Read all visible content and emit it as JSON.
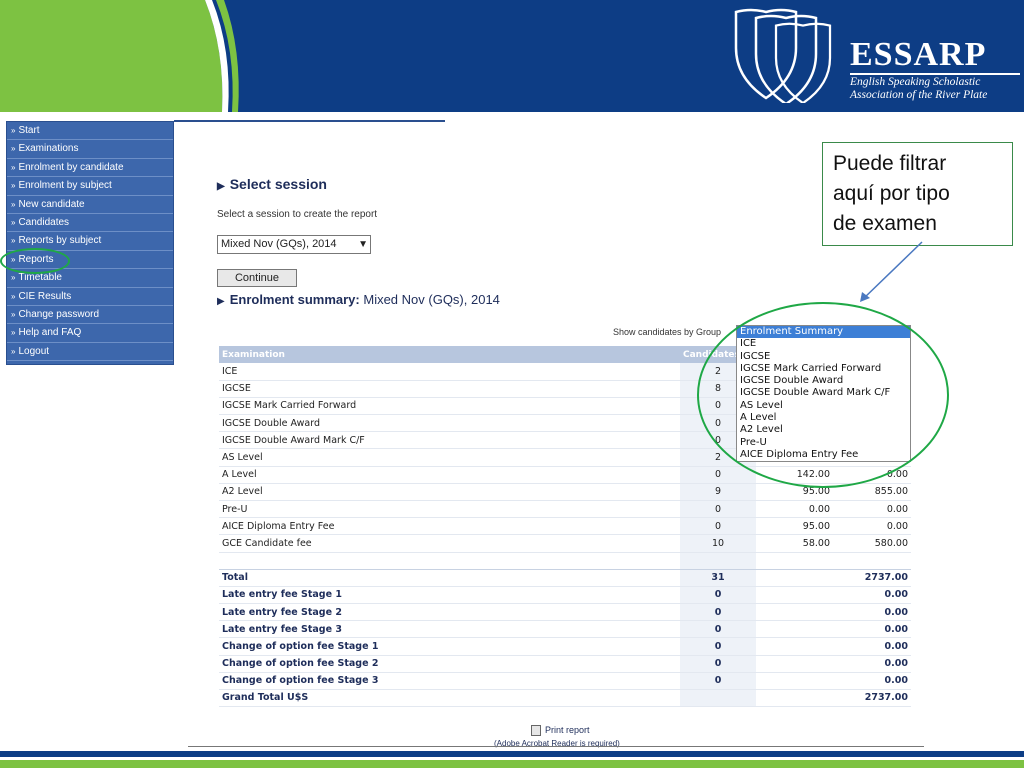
{
  "header": {
    "logo_title": "ESSARP",
    "logo_subtitle_line1": "English Speaking Scholastic",
    "logo_subtitle_line2": "Association of the River Plate",
    "brand_blue": "#0d3d85",
    "brand_green": "#7dc242"
  },
  "sidebar": {
    "items": [
      {
        "label": "Start"
      },
      {
        "label": "Examinations"
      },
      {
        "label": "Enrolment by candidate"
      },
      {
        "label": "Enrolment by subject"
      },
      {
        "label": "New candidate"
      },
      {
        "label": "Candidates"
      },
      {
        "label": "Reports by subject"
      },
      {
        "label": "Reports"
      },
      {
        "label": "Timetable"
      },
      {
        "label": "CIE Results"
      },
      {
        "label": "Change password"
      },
      {
        "label": "Help and FAQ"
      },
      {
        "label": "Logout"
      }
    ]
  },
  "select_session": {
    "title": "Select session",
    "instruction": "Select a session to create the report",
    "selected_value": "Mixed Nov (GQs), 2014",
    "continue_label": "Continue"
  },
  "summary": {
    "title_bold": "Enrolment summary:",
    "title_rest": " Mixed Nov (GQs), 2014",
    "group_label": "Show candidates by Group",
    "table_headers": [
      "Examination",
      "Candidates"
    ],
    "rows": [
      {
        "name": "ICE",
        "cand": "2",
        "fee": "",
        "total": ""
      },
      {
        "name": "IGCSE",
        "cand": "8",
        "fee": "",
        "total": ""
      },
      {
        "name": "IGCSE Mark Carried Forward",
        "cand": "0",
        "fee": "",
        "total": ""
      },
      {
        "name": "IGCSE Double Award",
        "cand": "0",
        "fee": "",
        "total": ""
      },
      {
        "name": "IGCSE Double Award Mark C/F",
        "cand": "0",
        "fee": "",
        "total": ""
      },
      {
        "name": "AS Level",
        "cand": "2",
        "fee": "",
        "total": ""
      },
      {
        "name": "A Level",
        "cand": "0",
        "fee": "142.00",
        "total": "0.00"
      },
      {
        "name": "A2 Level",
        "cand": "9",
        "fee": "95.00",
        "total": "855.00"
      },
      {
        "name": "Pre-U",
        "cand": "0",
        "fee": "0.00",
        "total": "0.00"
      },
      {
        "name": "AICE Diploma Entry Fee",
        "cand": "0",
        "fee": "95.00",
        "total": "0.00"
      },
      {
        "name": "GCE Candidate fee",
        "cand": "10",
        "fee": "58.00",
        "total": "580.00"
      }
    ],
    "totals": [
      {
        "name": "Total",
        "cand": "31",
        "total": "2737.00"
      },
      {
        "name": "Late entry fee Stage 1",
        "cand": "0",
        "total": "0.00"
      },
      {
        "name": "Late entry fee Stage 2",
        "cand": "0",
        "total": "0.00"
      },
      {
        "name": "Late entry fee Stage 3",
        "cand": "0",
        "total": "0.00"
      },
      {
        "name": "Change of option fee Stage 1",
        "cand": "0",
        "total": "0.00"
      },
      {
        "name": "Change of option fee Stage 2",
        "cand": "0",
        "total": "0.00"
      },
      {
        "name": "Change of option fee Stage 3",
        "cand": "0",
        "total": "0.00"
      },
      {
        "name": "Grand Total U$S",
        "cand": "",
        "total": "2737.00"
      }
    ]
  },
  "group_list": {
    "options": [
      "Enrolment Summary",
      "ICE",
      "IGCSE",
      "IGCSE Mark Carried Forward",
      "IGCSE Double Award",
      "IGCSE Double Award Mark C/F",
      "AS Level",
      "A Level",
      "A2 Level",
      "Pre-U",
      "AICE Diploma Entry Fee"
    ],
    "selected_index": 0
  },
  "callout": {
    "line1": "Puede filtrar",
    "line2": "aquí por tipo",
    "line3": "de examen"
  },
  "footer": {
    "print_label": "Print report",
    "print_note": "(Adobe Acrobat Reader is required)"
  }
}
